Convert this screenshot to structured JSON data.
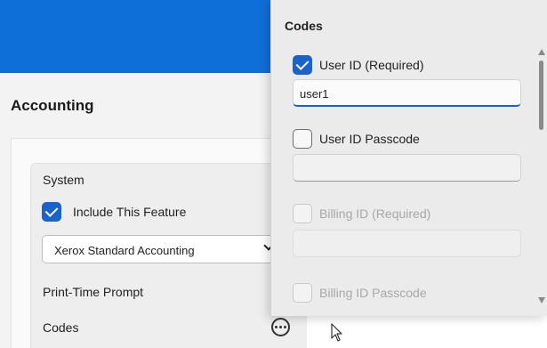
{
  "page": {
    "title": "Accounting"
  },
  "system": {
    "section_label": "System",
    "include_feature_label": "Include This Feature",
    "include_feature_checked": true,
    "accounting_select_value": "Xerox Standard Accounting",
    "print_time_prompt_label": "Print-Time Prompt",
    "codes_label": "Codes",
    "codes_button_icon": "more-horizontal-icon"
  },
  "codes_panel": {
    "title": "Codes",
    "items": [
      {
        "label": "User ID (Required)",
        "checked": true,
        "enabled": true,
        "field_value": "user1"
      },
      {
        "label": "User ID Passcode",
        "checked": false,
        "enabled": true,
        "field_value": ""
      },
      {
        "label": "Billing ID (Required)",
        "checked": false,
        "enabled": false,
        "field_value": ""
      },
      {
        "label": "Billing ID Passcode",
        "checked": false,
        "enabled": false
      }
    ]
  },
  "colors": {
    "header_blue": "#0f6fd8",
    "accent_blue": "#1a63c9"
  }
}
